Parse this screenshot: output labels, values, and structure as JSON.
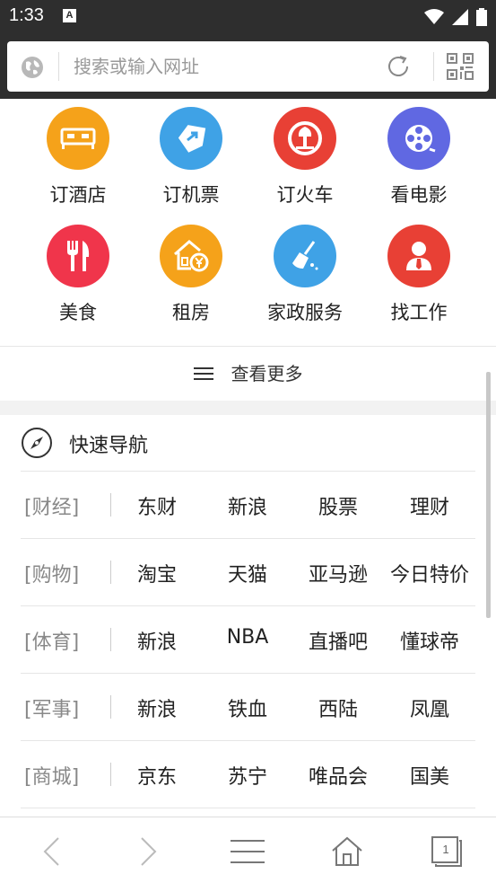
{
  "status_bar": {
    "time": "1:33",
    "notification_letter": "A"
  },
  "address_bar": {
    "placeholder": "搜索或输入网址"
  },
  "shortcuts": [
    {
      "label": "订酒店",
      "icon": "bed-icon",
      "color": "#f5a21a"
    },
    {
      "label": "订机票",
      "icon": "plane-tag-icon",
      "color": "#3fa2e6"
    },
    {
      "label": "订火车",
      "icon": "train-logo-icon",
      "color": "#e84035"
    },
    {
      "label": "看电影",
      "icon": "film-reel-icon",
      "color": "#6068e2"
    },
    {
      "label": "美食",
      "icon": "fork-knife-icon",
      "color": "#f0354b"
    },
    {
      "label": "租房",
      "icon": "house-yen-icon",
      "color": "#f5a21a"
    },
    {
      "label": "家政服务",
      "icon": "broom-icon",
      "color": "#3fa2e6"
    },
    {
      "label": "找工作",
      "icon": "person-tie-icon",
      "color": "#e84035"
    }
  ],
  "view_more": {
    "label": "查看更多"
  },
  "quick_nav": {
    "title": "快速导航",
    "rows": [
      {
        "category": "[财经]",
        "links": [
          "东财",
          "新浪",
          "股票",
          "理财"
        ]
      },
      {
        "category": "[购物]",
        "links": [
          "淘宝",
          "天猫",
          "亚马逊",
          "今日特价"
        ]
      },
      {
        "category": "[体育]",
        "links": [
          "新浪",
          "NBA",
          "直播吧",
          "懂球帝"
        ]
      },
      {
        "category": "[军事]",
        "links": [
          "新浪",
          "铁血",
          "西陆",
          "凤凰"
        ]
      },
      {
        "category": "[商城]",
        "links": [
          "京东",
          "苏宁",
          "唯品会",
          "国美"
        ]
      }
    ]
  },
  "bottom_bar": {
    "tab_count": "1"
  }
}
